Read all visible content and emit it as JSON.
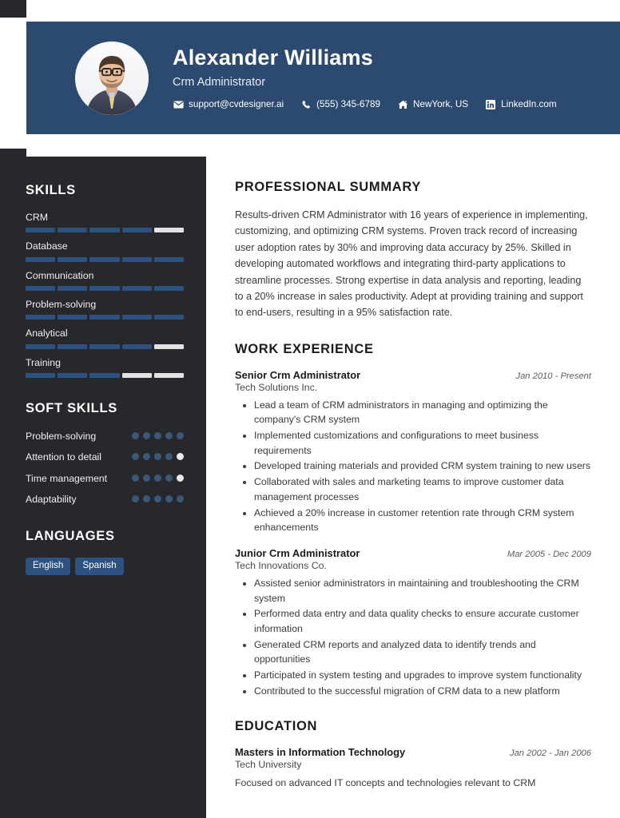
{
  "header": {
    "name": "Alexander Williams",
    "role": "Crm Administrator",
    "contacts": [
      {
        "icon": "envelope-icon",
        "label": "support@cvdesigner.ai"
      },
      {
        "icon": "phone-icon",
        "label": "(555) 345-6789"
      },
      {
        "icon": "home-icon",
        "label": "NewYork, US"
      },
      {
        "icon": "linkedin-icon",
        "label": "LinkedIn.com"
      }
    ],
    "avatar_alt": "profile-photo"
  },
  "sidebar": {
    "skills_heading": "SKILLS",
    "skills": [
      {
        "name": "CRM",
        "level": 4,
        "max": 5
      },
      {
        "name": "Database",
        "level": 5,
        "max": 5
      },
      {
        "name": "Communication",
        "level": 5,
        "max": 5
      },
      {
        "name": "Problem-solving",
        "level": 5,
        "max": 5
      },
      {
        "name": "Analytical",
        "level": 4,
        "max": 5
      },
      {
        "name": "Training",
        "level": 3,
        "max": 5
      }
    ],
    "soft_skills_heading": "SOFT SKILLS",
    "soft_skills": [
      {
        "name": "Problem-solving",
        "level": 5,
        "max": 5
      },
      {
        "name": "Attention to detail",
        "level": 4,
        "max": 5
      },
      {
        "name": "Time management",
        "level": 4,
        "max": 5
      },
      {
        "name": "Adaptability",
        "level": 5,
        "max": 5
      }
    ],
    "languages_heading": "LANGUAGES",
    "languages": [
      "English",
      "Spanish"
    ]
  },
  "main": {
    "summary_heading": "PROFESSIONAL SUMMARY",
    "summary_text": "Results-driven CRM Administrator with 16 years of experience in implementing, customizing, and optimizing CRM systems. Proven track record of increasing user adoption rates by 30% and improving data accuracy by 25%. Skilled in developing automated workflows and integrating third-party applications to streamline processes. Strong expertise in data analysis and reporting, leading to a 20% increase in sales productivity. Adept at providing training and support to end-users, resulting in a 95% satisfaction rate.",
    "experience_heading": "WORK EXPERIENCE",
    "experience": [
      {
        "title": "Senior Crm Administrator",
        "date": "Jan 2010 - Present",
        "org": "Tech Solutions Inc.",
        "bullets": [
          "Lead a team of CRM administrators in managing and optimizing the company's CRM system",
          "Implemented customizations and configurations to meet business requirements",
          "Developed training materials and provided CRM system training to new users",
          "Collaborated with sales and marketing teams to improve customer data management processes",
          "Achieved a 20% increase in customer retention rate through CRM system enhancements"
        ]
      },
      {
        "title": "Junior Crm Administrator",
        "date": "Mar 2005 - Dec 2009",
        "org": "Tech Innovations Co.",
        "bullets": [
          "Assisted senior administrators in maintaining and troubleshooting the CRM system",
          "Performed data entry and data quality checks to ensure accurate customer information",
          "Generated CRM reports and analyzed data to identify trends and opportunities",
          "Participated in system testing and upgrades to improve system functionality",
          "Contributed to the successful migration of CRM data to a new platform"
        ]
      }
    ],
    "education_heading": "EDUCATION",
    "education": [
      {
        "title": "Masters in Information Technology",
        "date": "Jan 2002 - Jan 2006",
        "org": "Tech University",
        "description": "Focused on advanced IT concepts and technologies relevant to CRM"
      }
    ]
  },
  "colors": {
    "header_blue": "#2c4a70",
    "sidebar_dark": "#26282c",
    "accent_blue": "#2d5180",
    "dot_blue": "#3a5878",
    "empty_gray": "#e3e3e3"
  }
}
